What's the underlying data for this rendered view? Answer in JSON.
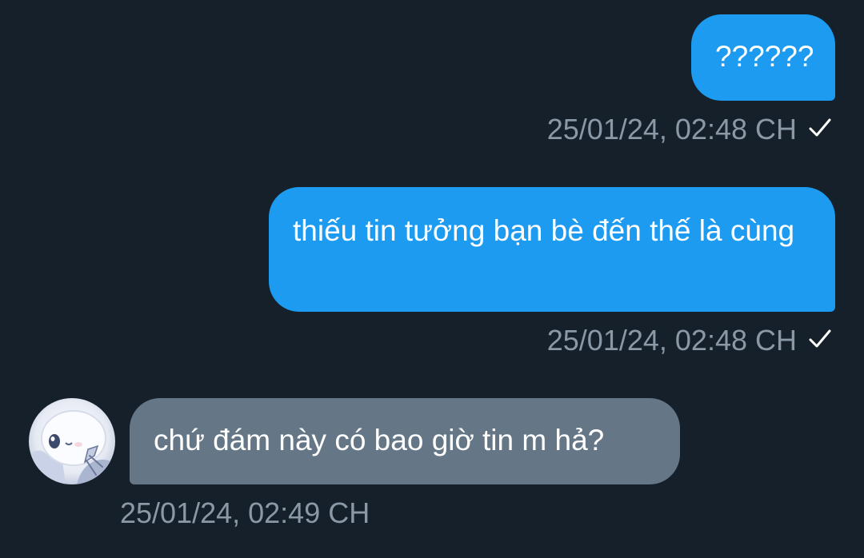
{
  "conversation": {
    "messages": [
      {
        "direction": "sent",
        "text": "??????",
        "timestamp": "25/01/24, 02:48 CH",
        "status_icon": "checkmark-icon"
      },
      {
        "direction": "sent",
        "text": "thiếu tin tưởng bạn bè đến thế là cùng",
        "timestamp": "25/01/24, 02:48 CH",
        "status_icon": "checkmark-icon"
      },
      {
        "direction": "received",
        "text": "chứ đám này có bao giờ tin m hả?",
        "timestamp": "25/01/24, 02:49 CH",
        "avatar_icon": "avatar-image"
      }
    ]
  },
  "colors": {
    "background": "#15202b",
    "sent_bubble": "#1d9bf0",
    "received_bubble": "#657786",
    "timestamp_text": "#8b98a5"
  }
}
